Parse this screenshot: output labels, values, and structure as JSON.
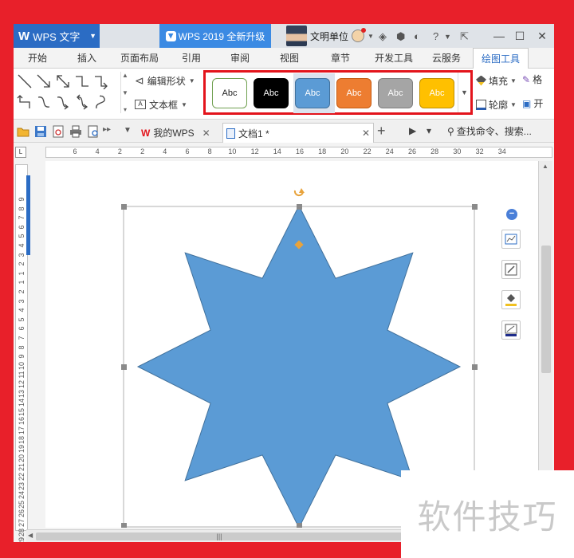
{
  "app": {
    "name": "WPS 文字",
    "promo_label": "WPS 2019 全新升级",
    "user_name": "文明单位"
  },
  "ribbon_tabs": [
    {
      "label": "开始"
    },
    {
      "label": "插入"
    },
    {
      "label": "页面布局"
    },
    {
      "label": "引用"
    },
    {
      "label": "审阅"
    },
    {
      "label": "视图"
    },
    {
      "label": "章节"
    },
    {
      "label": "开发工具"
    },
    {
      "label": "云服务"
    },
    {
      "label": "绘图工具",
      "active": true
    }
  ],
  "ribbon": {
    "edit_shape_label": "编辑形状",
    "text_box_label": "文本框",
    "fill_label": "填充",
    "outline_label": "轮廓",
    "format_brush_label": "格",
    "effects_label": "开",
    "shape_styles": [
      {
        "label": "Abc",
        "fill": "#ffffff",
        "border": "#70a050",
        "text": "#222222"
      },
      {
        "label": "Abc",
        "fill": "#000000",
        "border": "#000000",
        "text": "#ffffff"
      },
      {
        "label": "Abc",
        "fill": "#5b9bd5",
        "border": "#41719c",
        "text": "#ffffff"
      },
      {
        "label": "Abc",
        "fill": "#ed7d31",
        "border": "#c55a11",
        "text": "#ffffff"
      },
      {
        "label": "Abc",
        "fill": "#a5a5a5",
        "border": "#7f7f7f",
        "text": "#ffffff"
      },
      {
        "label": "Abc",
        "fill": "#ffc000",
        "border": "#bf9000",
        "text": "#ffffff"
      }
    ]
  },
  "doc_tabs": [
    {
      "label": "我的WPS"
    },
    {
      "label": "文档1 *",
      "active": true
    }
  ],
  "search_label": "查找命令、搜索...",
  "ruler": {
    "horizontal": [
      "6",
      "4",
      "2",
      "2",
      "4",
      "6",
      "8",
      "10",
      "12",
      "14",
      "16",
      "18",
      "20",
      "22",
      "24",
      "26",
      "28",
      "30",
      "32",
      "34"
    ],
    "vertical": [
      "9",
      "8",
      "7",
      "6",
      "5",
      "4",
      "3",
      "2",
      "1",
      "1",
      "2",
      "3",
      "4",
      "5",
      "6",
      "7",
      "8",
      "9",
      "10",
      "11",
      "12",
      "13",
      "14",
      "15",
      "16",
      "17",
      "18",
      "19",
      "20",
      "21",
      "22",
      "23",
      "24",
      "25",
      "26",
      "27",
      "28",
      "29"
    ]
  },
  "shape": {
    "type": "8-point-star",
    "fill": "#5b9bd5",
    "stroke": "#41719c"
  },
  "colors": {
    "app_blue": "#2b6cc4",
    "highlight_red": "#e3141c",
    "background_red": "#e8202a"
  },
  "watermark": "软件技巧"
}
